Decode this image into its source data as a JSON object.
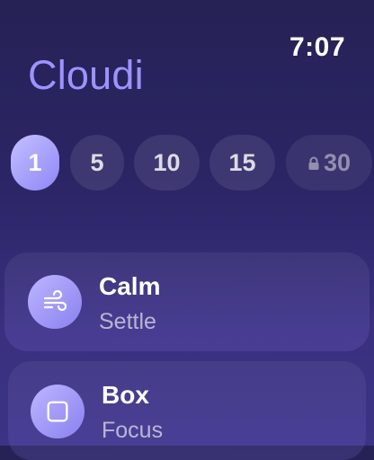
{
  "status": {
    "time": "7:07"
  },
  "app": {
    "title": "Cloudi"
  },
  "durations": [
    {
      "label": "1",
      "selected": true,
      "locked": false
    },
    {
      "label": "5",
      "selected": false,
      "locked": false
    },
    {
      "label": "10",
      "selected": false,
      "locked": false
    },
    {
      "label": "15",
      "selected": false,
      "locked": false
    },
    {
      "label": "30",
      "selected": false,
      "locked": true
    }
  ],
  "exercises": [
    {
      "title": "Calm",
      "subtitle": "Settle",
      "icon": "wind-icon"
    },
    {
      "title": "Box",
      "subtitle": "Focus",
      "icon": "square-icon"
    }
  ],
  "colors": {
    "accent": "#9c93ff",
    "background_top": "#262255",
    "background_bottom": "#3b3384"
  }
}
